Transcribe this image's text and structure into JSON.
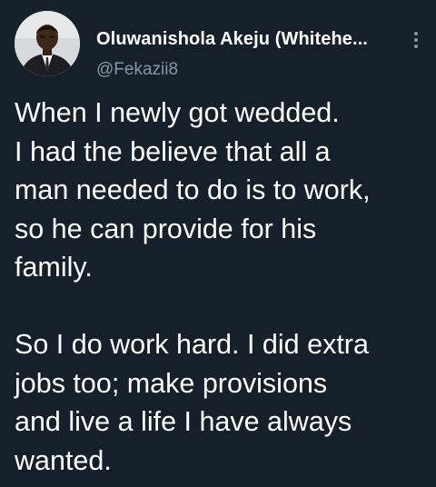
{
  "tweet": {
    "author_name": "Oluwanishola Akeju (Whitehe...",
    "handle": "@Fekazii8",
    "paragraphs": [
      {
        "lines": [
          "When I newly got wedded.",
          "I had the believe that all a",
          "man needed to do is to work,",
          "so he can provide for his",
          "family."
        ]
      },
      {
        "lines": [
          "So I do work hard. I did extra",
          "jobs too; make provisions",
          "and live a life I have always",
          "wanted."
        ]
      }
    ]
  },
  "icons": {
    "avatar": "profile-photo",
    "more": "more-options-vertical-icon"
  },
  "colors": {
    "background": "#15202b",
    "text": "#ffffff",
    "secondary_text": "#8899a6"
  }
}
